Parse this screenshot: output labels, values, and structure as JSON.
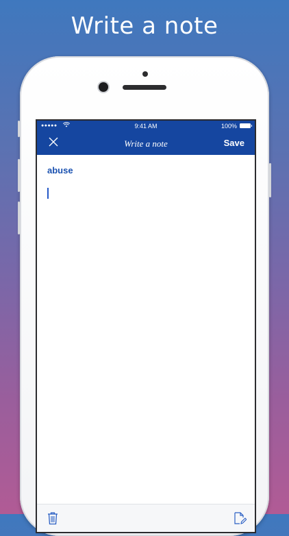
{
  "headline": "Write a note",
  "status_bar": {
    "signal": "●●●●●",
    "time": "9:41 AM",
    "battery": "100%"
  },
  "nav_bar": {
    "title": "Write a note",
    "save_label": "Save",
    "close_icon": "close-icon"
  },
  "note": {
    "word": "abuse",
    "body": ""
  },
  "toolbar": {
    "left_icon": "trash-icon",
    "right_icon": "edit-note-icon"
  },
  "colors": {
    "accent": "#1546a0",
    "word": "#1a51b0"
  }
}
